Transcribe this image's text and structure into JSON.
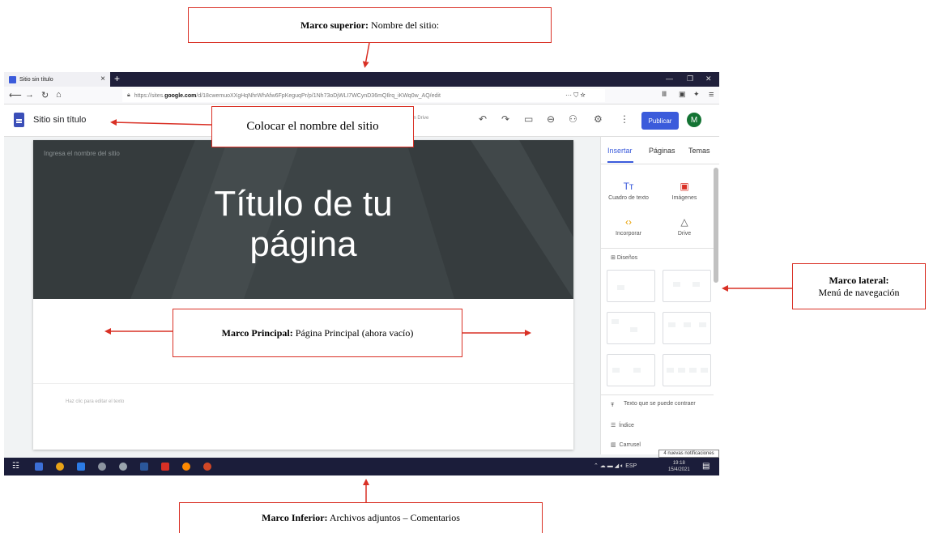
{
  "annotations": {
    "top": {
      "label_bold": "Marco superior:",
      "label_text": " Nombre del sitio:"
    },
    "site_name": {
      "label_text": "Colocar el nombre del sitio"
    },
    "main": {
      "label_bold": "Marco Principal:",
      "label_text": " Página Principal (ahora vacío)"
    },
    "side": {
      "label_bold": "Marco lateral:",
      "label_text": "Menú de navegación"
    },
    "bottom": {
      "label_bold": "Marco Inferior:",
      "label_text": " Archivos adjuntos – Comentarios"
    }
  },
  "browser": {
    "tab_title": "Sitio sin título",
    "tab_close": "×",
    "new_tab": "+",
    "url_prefix": "https://sites.",
    "url_host": "google.com",
    "url_rest": "/d/18cwemuoXXgHqNhrWhAfw6FpKeguqPr/p/1Nh73oDjWLI7WCynD36mQIlrq_iKWq0w_AQ/edit",
    "url_actions": "··· ⛉ ☆"
  },
  "app": {
    "site_title": "Sitio sin título",
    "saved_note": "cambios en Drive",
    "publish_label": "Publicar",
    "avatar_letter": "M"
  },
  "page": {
    "site_name_placeholder": "Ingresa el nombre del sitio",
    "hero_title_line1": "Título de tu",
    "hero_title_line2": "página",
    "edit_placeholder": "Haz clic para editar el texto"
  },
  "panel": {
    "tabs": [
      "Insertar",
      "Páginas",
      "Temas"
    ],
    "insert_items": [
      {
        "label": "Cuadro de texto",
        "icon": "text-box-icon"
      },
      {
        "label": "Imágenes",
        "icon": "image-icon"
      },
      {
        "label": "Incorporar",
        "icon": "embed-icon"
      },
      {
        "label": "Drive",
        "icon": "drive-icon"
      }
    ],
    "designs_label": "Diseños",
    "collapsible_text": "Texto que se puede contraer",
    "index_label": "Índice",
    "carousel_label": "Carrusel",
    "notification": "4 nuevas notificaciones"
  },
  "taskbar": {
    "tray_text": "ESP",
    "time": "19:18",
    "date": "15/4/2021"
  },
  "colors": {
    "annotation_border": "#d93025",
    "accent_blue": "#3b5bdb",
    "hero_bg": "#3d4446",
    "taskbar": "#1b1d3a"
  }
}
